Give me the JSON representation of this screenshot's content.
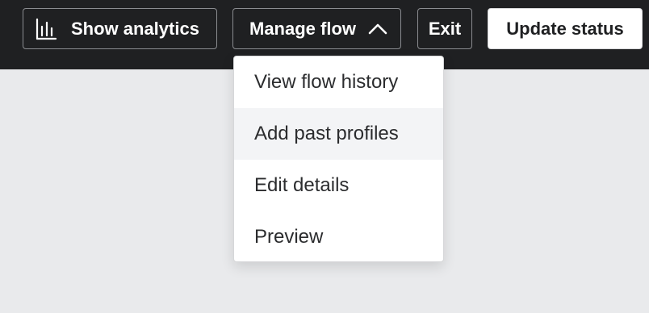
{
  "header": {
    "analytics_label": "Show analytics",
    "manage_label": "Manage flow",
    "exit_label": "Exit",
    "update_label": "Update status"
  },
  "menu": {
    "items": [
      {
        "label": "View flow history"
      },
      {
        "label": "Add past profiles"
      },
      {
        "label": "Edit details"
      },
      {
        "label": "Preview"
      }
    ]
  },
  "colors": {
    "topbar": "#1f2022",
    "background": "#e9eaec",
    "hover": "#f3f4f6"
  },
  "icons": {
    "analytics": "bar-chart-icon",
    "manage": "chevron-up-icon"
  }
}
